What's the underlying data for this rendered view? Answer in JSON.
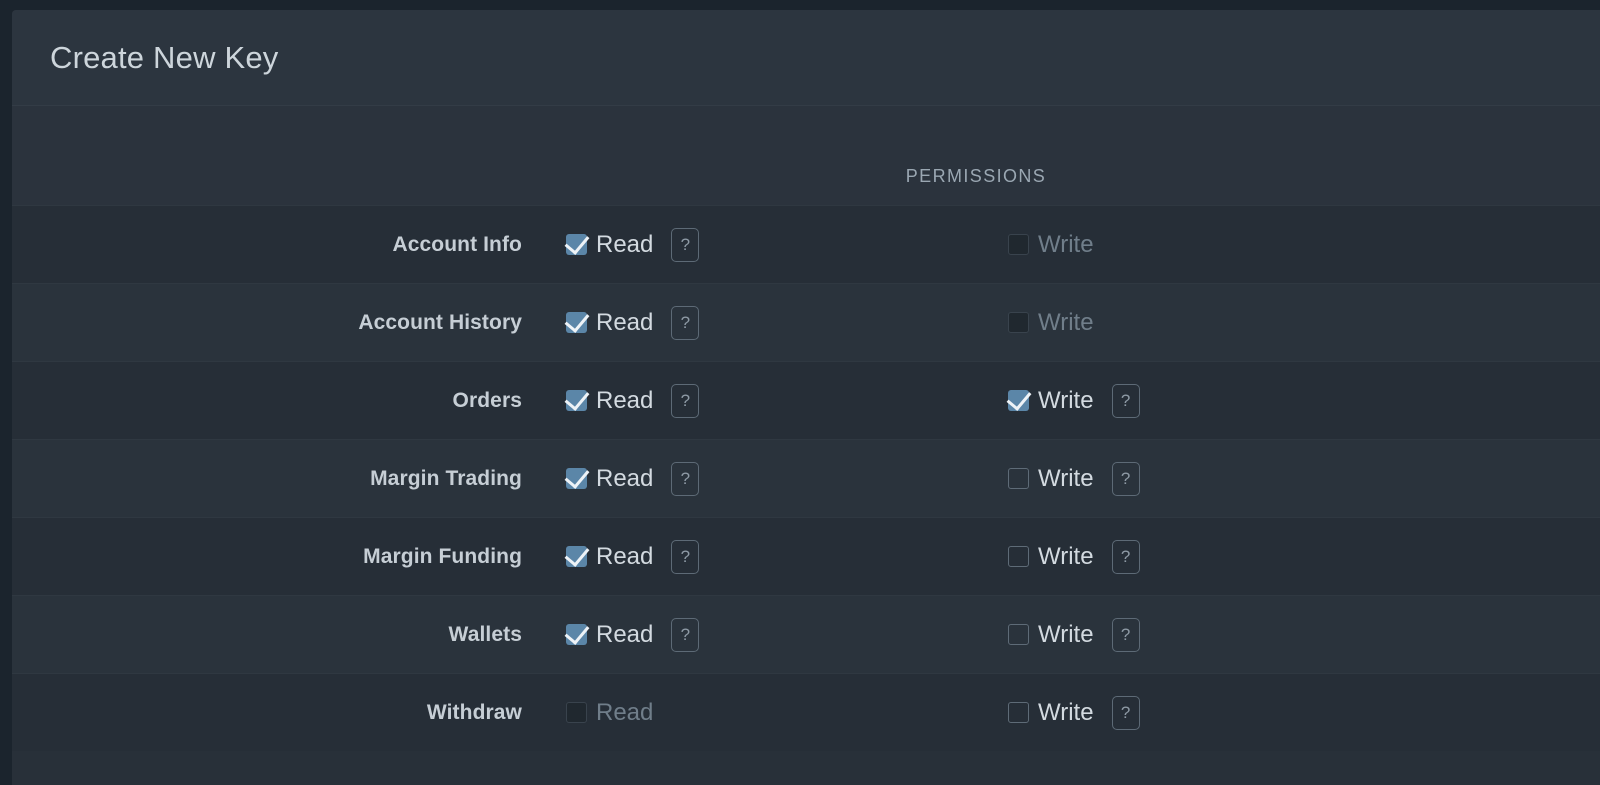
{
  "panel": {
    "title": "Create New Key"
  },
  "table": {
    "permissions_header": "PERMISSIONS",
    "read_label": "Read",
    "write_label": "Write",
    "help_glyph": "?",
    "rows": [
      {
        "label": "Account Info",
        "read": {
          "label": "Read",
          "checked": true,
          "disabled": false,
          "has_help": true
        },
        "write": {
          "label": "Write",
          "checked": false,
          "disabled": true,
          "has_help": false
        }
      },
      {
        "label": "Account History",
        "read": {
          "label": "Read",
          "checked": true,
          "disabled": false,
          "has_help": true
        },
        "write": {
          "label": "Write",
          "checked": false,
          "disabled": true,
          "has_help": false
        }
      },
      {
        "label": "Orders",
        "read": {
          "label": "Read",
          "checked": true,
          "disabled": false,
          "has_help": true
        },
        "write": {
          "label": "Write",
          "checked": true,
          "disabled": false,
          "has_help": true
        }
      },
      {
        "label": "Margin Trading",
        "read": {
          "label": "Read",
          "checked": true,
          "disabled": false,
          "has_help": true
        },
        "write": {
          "label": "Write",
          "checked": false,
          "disabled": false,
          "has_help": true
        }
      },
      {
        "label": "Margin Funding",
        "read": {
          "label": "Read",
          "checked": true,
          "disabled": false,
          "has_help": true
        },
        "write": {
          "label": "Write",
          "checked": false,
          "disabled": false,
          "has_help": true
        }
      },
      {
        "label": "Wallets",
        "read": {
          "label": "Read",
          "checked": true,
          "disabled": false,
          "has_help": true
        },
        "write": {
          "label": "Write",
          "checked": false,
          "disabled": false,
          "has_help": true
        }
      },
      {
        "label": "Withdraw",
        "read": {
          "label": "Read",
          "checked": false,
          "disabled": true,
          "has_help": false
        },
        "write": {
          "label": "Write",
          "checked": false,
          "disabled": false,
          "has_help": true
        }
      }
    ]
  },
  "colors": {
    "page_background": "#1b242d",
    "panel_background": "#283039",
    "header_background": "#2c353f",
    "row_odd": "#262e37",
    "row_even": "#2a333c",
    "checkbox_accent": "#5b86a8",
    "text_primary": "#cdd5db",
    "text_muted": "#707e8a"
  }
}
